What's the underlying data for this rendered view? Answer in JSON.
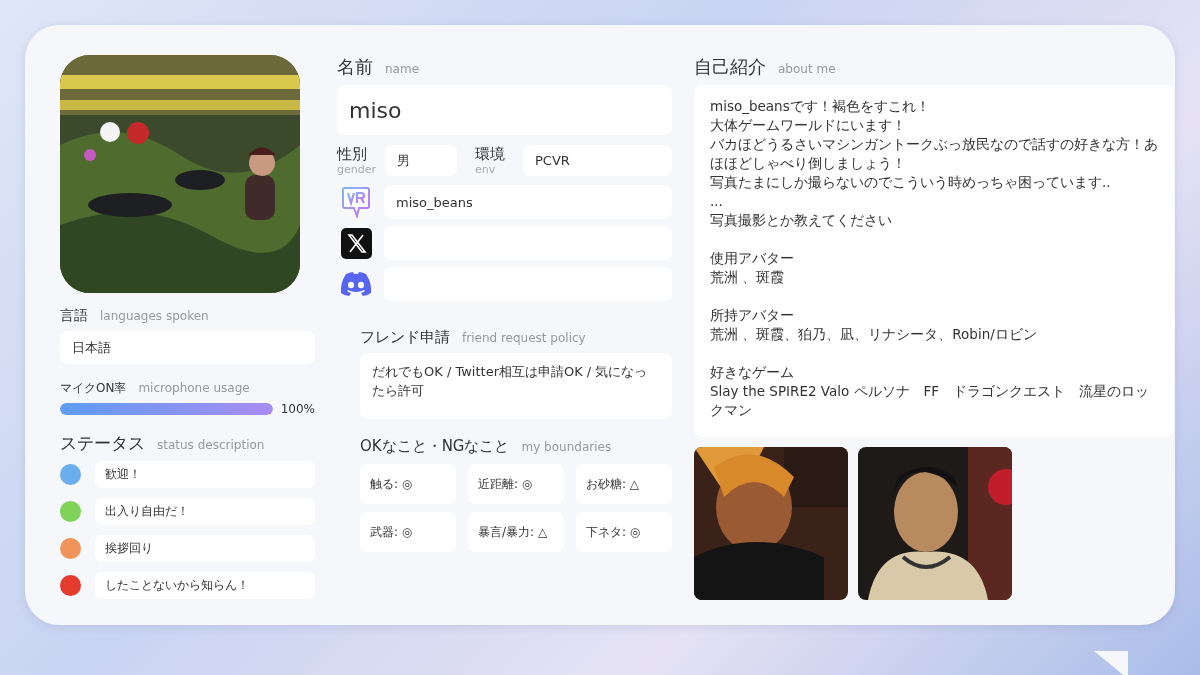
{
  "languages": {
    "label": "言語",
    "sublabel": "languages spoken",
    "value": "日本語"
  },
  "mic": {
    "label": "マイクON率",
    "sublabel": "microphone usage",
    "level": 1,
    "reading": "100%"
  },
  "status": {
    "label": "ステータス",
    "sublabel": "status description",
    "items": [
      {
        "text": "歓迎！",
        "color": "#6aaeee"
      },
      {
        "text": "出入り自由だ！",
        "color": "#7fd35a"
      },
      {
        "text": "挨拶回り",
        "color": "#f0945a"
      },
      {
        "text": "したことないから知らん！",
        "color": "#e53a2e"
      }
    ]
  },
  "name": {
    "label": "名前",
    "sublabel": "name",
    "value": "miso"
  },
  "gender": {
    "label": "性別",
    "sublabel": "gender",
    "value": "男"
  },
  "env": {
    "label": "環境",
    "sublabel": "env",
    "value": "PCVR"
  },
  "accounts": [
    {
      "kind": "vrchat",
      "value": "miso_beans"
    },
    {
      "kind": "x"
    },
    {
      "kind": "discord"
    }
  ],
  "friend_request": {
    "label": "フレンド申請",
    "sublabel": "friend request policy",
    "value": "だれでもOK / Twitter相互は申請OK / 気になったら許可"
  },
  "boundaries": {
    "label": "OKなこと・NGなこと",
    "sublabel": "my boundaries",
    "items": [
      "触る: ◎",
      "近距離: ◎",
      "お砂糖: △",
      "武器: ◎",
      "暴言/暴力: △",
      "下ネタ: ◎"
    ]
  },
  "about": {
    "label": "自己紹介",
    "sublabel": "about me",
    "paragraphs": [
      [
        "miso_beansです！褐色をすこれ！",
        "大体ゲームワールドにいます！",
        "バカほどうるさいマシンガントークぶっ放民なので話すの好きな方！あほほどしゃべり倒しましょう！",
        "写真たまにしか撮らないのでこういう時めっちゃ困っています..",
        "...",
        "写真撮影とか教えてください"
      ],
      [
        "使用アバター",
        "荒洲 、斑霞"
      ],
      [
        "所持アバター",
        "荒洲 、斑霞、狛乃、凪、リナシータ、Robin/ロビン"
      ],
      [
        "好きなゲーム",
        "Slay the SPIRE2 Valo ペルソナ　FF　ドラゴンクエスト　流星のロックマン"
      ]
    ]
  }
}
